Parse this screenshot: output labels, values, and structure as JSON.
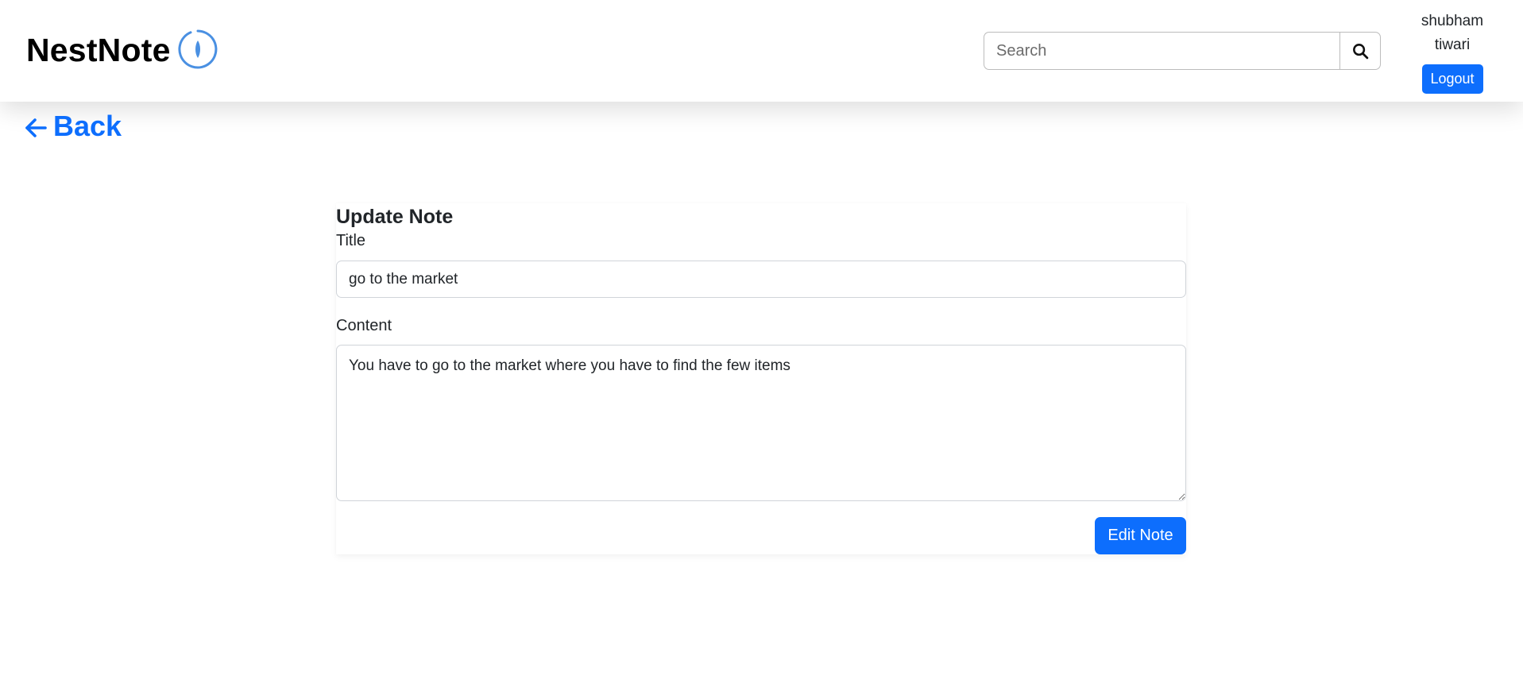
{
  "brand": {
    "name": "NestNote",
    "logo_icon": "leaf-circle-icon",
    "accent_color": "#4a90e2"
  },
  "search": {
    "placeholder": "Search",
    "value": "",
    "button_icon": "search-icon"
  },
  "user": {
    "first_name": "shubham",
    "last_name": "tiwari",
    "logout_label": "Logout"
  },
  "nav": {
    "back_label": "Back",
    "back_icon": "arrow-left-icon"
  },
  "form": {
    "heading": "Update Note",
    "title_label": "Title",
    "title_value": "go to the market",
    "content_label": "Content",
    "content_value": "You have to go to the market where you have to find the few items",
    "submit_label": "Edit Note"
  },
  "colors": {
    "primary": "#0d6efd",
    "text": "#212529"
  }
}
